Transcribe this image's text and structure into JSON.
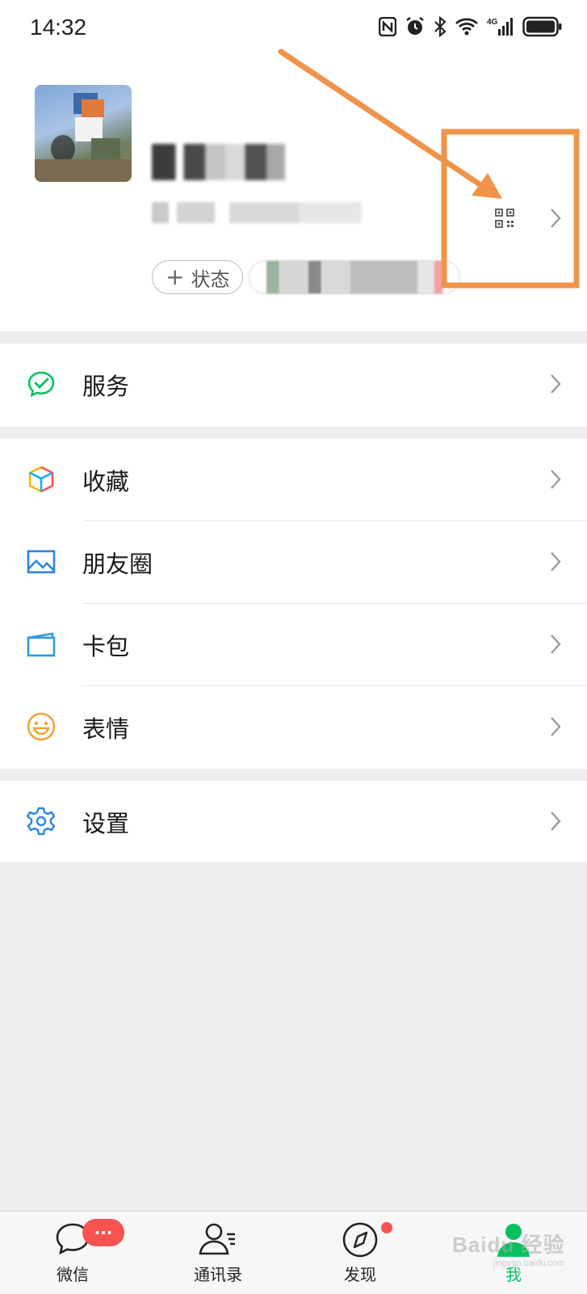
{
  "status_bar": {
    "time": "14:32",
    "icons": [
      "nfc-icon",
      "alarm-icon",
      "bluetooth-icon",
      "wifi-icon",
      "signal-4g-icon",
      "battery-icon"
    ]
  },
  "profile": {
    "status_button_label": "状态",
    "status_button_plus": "+"
  },
  "menu": {
    "services": {
      "label": "服务",
      "icon": "services-icon"
    },
    "favorites": {
      "label": "收藏",
      "icon": "favorites-cube-icon"
    },
    "moments": {
      "label": "朋友圈",
      "icon": "moments-image-icon"
    },
    "cards": {
      "label": "卡包",
      "icon": "card-wallet-icon"
    },
    "stickers": {
      "label": "表情",
      "icon": "smiley-icon"
    },
    "settings": {
      "label": "设置",
      "icon": "gear-icon"
    }
  },
  "tabbar": {
    "chats": {
      "label": "微信",
      "badge": "···"
    },
    "contacts": {
      "label": "通讯录"
    },
    "discover": {
      "label": "发现"
    },
    "me": {
      "label": "我"
    }
  },
  "watermark": {
    "text": "Baidu 经验",
    "sub": "jingyan.baidu.com"
  },
  "colors": {
    "accent_green": "#07c160",
    "badge_red": "#fa5151",
    "annotation_orange": "#f0944a"
  }
}
